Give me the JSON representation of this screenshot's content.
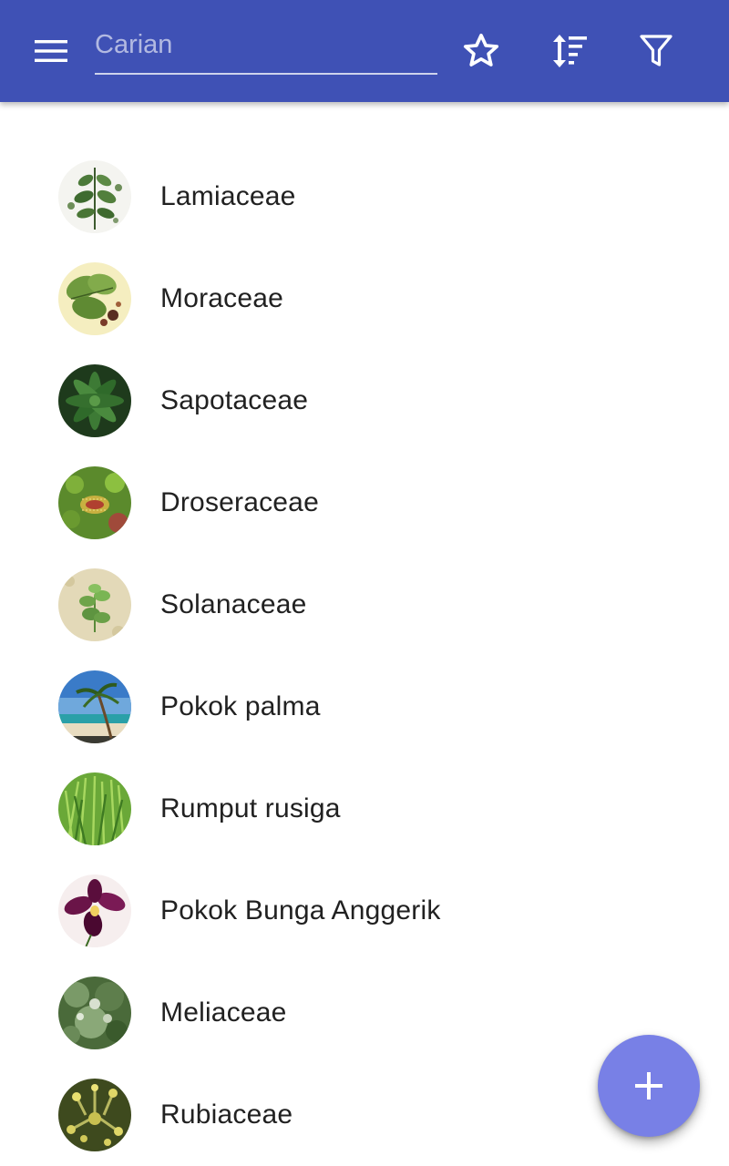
{
  "appbar": {
    "background_color": "#3f51b5",
    "menu_icon": "hamburger-menu-icon",
    "search": {
      "placeholder": "Carian",
      "value": ""
    },
    "actions": [
      {
        "name": "favorites",
        "icon": "star-outline-icon"
      },
      {
        "name": "sort",
        "icon": "sort-icon"
      },
      {
        "name": "filter",
        "icon": "filter-icon"
      }
    ]
  },
  "list": {
    "items": [
      {
        "label": "Lamiaceae",
        "thumbnail": "mint-illustration"
      },
      {
        "label": "Moraceae",
        "thumbnail": "fig-leaf-illustration"
      },
      {
        "label": "Sapotaceae",
        "thumbnail": "dark-green-leaves-photo"
      },
      {
        "label": "Droseraceae",
        "thumbnail": "venus-flytrap-photo"
      },
      {
        "label": "Solanaceae",
        "thumbnail": "small-plant-sand-photo"
      },
      {
        "label": "Pokok palma",
        "thumbnail": "palm-beach-photo"
      },
      {
        "label": "Rumput rusiga",
        "thumbnail": "grass-photo"
      },
      {
        "label": "Pokok Bunga Anggerik",
        "thumbnail": "purple-orchid-photo"
      },
      {
        "label": "Meliaceae",
        "thumbnail": "meliaceae-foliage-photo"
      },
      {
        "label": "Rubiaceae",
        "thumbnail": "yellow-flowers-photo"
      }
    ]
  },
  "fab": {
    "icon": "plus-icon",
    "color": "#7880e6"
  }
}
